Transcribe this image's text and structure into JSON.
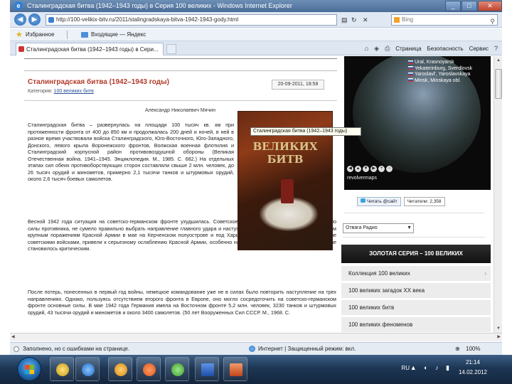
{
  "window": {
    "title": "Сталинградская битва (1942–1943 годы) в Серия 100 великих - Windows Internet Explorer",
    "min": "_",
    "max": "□",
    "close": "✕"
  },
  "address": {
    "url": "http://100-velikix-bitv.ru/2011/stalingradskaya-bitva-1942-1943-gody.html",
    "search_placeholder": "Bing"
  },
  "favorites": {
    "label": "Избранное",
    "link": "Входящие — Яндекс"
  },
  "tab": {
    "label": "Сталинградская битва (1942–1943 годы) в Сери...",
    "commands": [
      "Страница",
      "Безопасность",
      "Сервис"
    ]
  },
  "article": {
    "title": "Сталинградская битва (1942–1943 годы)",
    "category_prefix": "Категория:",
    "category_link": "100 великих битв",
    "date": "20-09-2011, 18:58",
    "author": "Александр Николаевич Мячин",
    "paragraph1": "Сталинградская битва – развернулась на площади 100 тысяч кв. км при протяженности фронта от 400 до 850 км и продолжалась 200 дней и ночей, в ней в разное время участвовали войска Сталинградского, Юго-Восточного, Юго-Западного, Донского, левого крыла Воронежского фронтов, Волжская военная флотилия и Сталинградский корпусной район противовоздушной обороны (Великая Отечественная война. 1941–1945. Энциклопедия. М., 1985. С. 682.) На отдельных этапах сил обеих противоборствующих сторон составляли свыше 2 млн. человек, до 26 тысяч орудий и минометов, примерно 2,1 тысячи танков и штурмовых орудий, около 2,6 тысяч боевых самолетов.",
    "paragraph2": "Весной 1942 года ситуация на советско-германском фронте ухудшилась. Советское верховное командование недооценило силы противника, не сумело правильно выбрать направление главного удара и наступательных действий. Это привело к двум крупным поражениям Красной Армии в мае на Керченском полуострове и под Харьковом. Вынуждены потери, понесенные советскими войсками, привели к серьезному ослаблению Красной Армии, особенно на южном участке фронта, где положение становилось критическим.",
    "paragraph3": "После потерь, понесенных в первый год войны, немецкое командование уже не в силах было повторить наступление на трех направлениях. Однако, пользуясь отсутствием второго фронта в Европе, оно могло сосредоточить на советско-германском фронте основные силы. В мае 1942 года Германия имела на Восточном фронте 5,2 млн. человек, 3230 танков и штурмовых орудий, 43 тысячи орудий и минометов и около 3400 самолетов. (50 лет Вооруженных Сил СССР. М., 1968. С."
  },
  "book": {
    "title": "ВЕЛИКИХ БИТВ",
    "tooltip": "Сталинградская битва (1942–1943 годы)"
  },
  "globe": {
    "labels": [
      "Ural, Krasnoyarsk",
      "Yekaterinburg, Sverdlovsk",
      "Yaroslavl', Yaroslavskaya",
      "Minsk, Minskaya obl."
    ],
    "brand": "revolvermaps",
    "controls": [
      "◀",
      "▲",
      "▼",
      "▶",
      "+",
      "−"
    ]
  },
  "share": {
    "tweet_label": "Читать @сайт",
    "count_label": "Читатели: 2,358"
  },
  "radio": {
    "selected": "Отвага Радио"
  },
  "series": {
    "header": "ЗОЛОТАЯ СЕРИЯ – 100 ВЕЛИКИХ",
    "items": [
      "Коллекция 100 великих",
      "100 великих загадок XX века",
      "100 великих битв",
      "100 великих феноменов"
    ]
  },
  "status": {
    "text": "Заполнено, но с ошибками на странице.",
    "zone": "Интернет | Защищенный режим: вкл.",
    "zoom": "100%"
  },
  "taskbar": {
    "lang": "RU",
    "time": "21:14",
    "date": "14.02.2012"
  }
}
